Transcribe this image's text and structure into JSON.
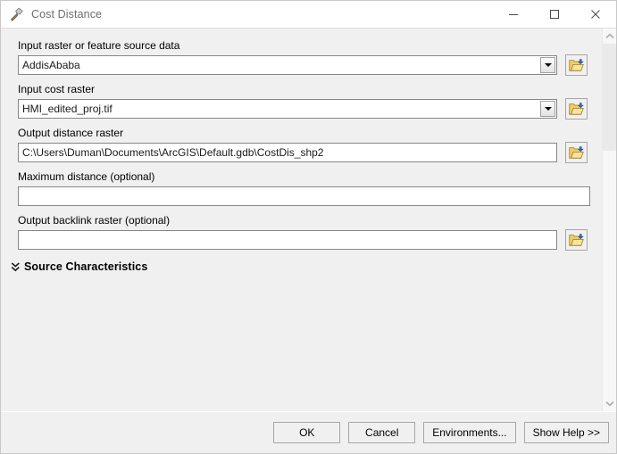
{
  "window": {
    "title": "Cost Distance",
    "icon": "hammer-tool-icon",
    "controls": {
      "minimize": "Minimize",
      "maximize": "Maximize",
      "close": "Close"
    }
  },
  "form": {
    "fields": [
      {
        "label": "Input raster or feature source data",
        "value": "AddisAbaba",
        "type": "combobox",
        "has_browse": true,
        "name": "input-source-data"
      },
      {
        "label": "Input cost raster",
        "value": "HMI_edited_proj.tif",
        "type": "combobox",
        "has_browse": true,
        "name": "input-cost-raster"
      },
      {
        "label": "Output distance raster",
        "value": "C:\\Users\\Duman\\Documents\\ArcGIS\\Default.gdb\\CostDis_shp2",
        "type": "text",
        "has_browse": true,
        "name": "output-distance-raster"
      },
      {
        "label": "Maximum distance (optional)",
        "value": "",
        "type": "text",
        "has_browse": false,
        "name": "maximum-distance"
      },
      {
        "label": "Output backlink raster (optional)",
        "value": "",
        "type": "text",
        "has_browse": true,
        "name": "output-backlink-raster"
      }
    ],
    "section": {
      "title": "Source Characteristics",
      "expander": "double-chevron-down-icon"
    }
  },
  "footer": {
    "buttons": [
      {
        "label": "OK",
        "name": "ok-button"
      },
      {
        "label": "Cancel",
        "name": "cancel-button"
      },
      {
        "label": "Environments...",
        "name": "environments-button"
      },
      {
        "label": "Show Help >>",
        "name": "show-help-button"
      }
    ]
  },
  "scrollbar": {
    "up": "scroll-up-arrow",
    "down": "scroll-down-arrow"
  },
  "colors": {
    "background": "#f0f0f0",
    "titlebar": "#ffffff",
    "field_border": "#878787",
    "folder_icon": "#e8b93b",
    "title_text": "#6d6d6d"
  }
}
